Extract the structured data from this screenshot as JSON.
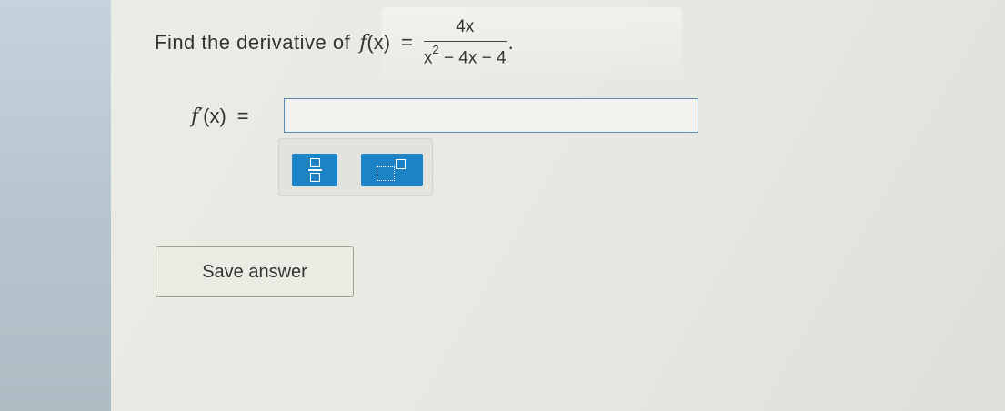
{
  "question": {
    "prompt": "Find the derivative of",
    "function_lhs": "f",
    "function_arg": "(x)",
    "equals": "=",
    "numerator": "4x",
    "denominator_base": "x",
    "denominator_exp": "2",
    "denominator_rest": " − 4x − 4",
    "period": "."
  },
  "answer": {
    "label_f": "f′",
    "label_arg": "(x)",
    "equals": "=",
    "value": ""
  },
  "palette": {
    "tools": [
      {
        "icon": "fraction-icon"
      },
      {
        "icon": "exponent-icon"
      }
    ],
    "accent": "#1b83c6"
  },
  "save_button": {
    "label": "Save answer"
  }
}
